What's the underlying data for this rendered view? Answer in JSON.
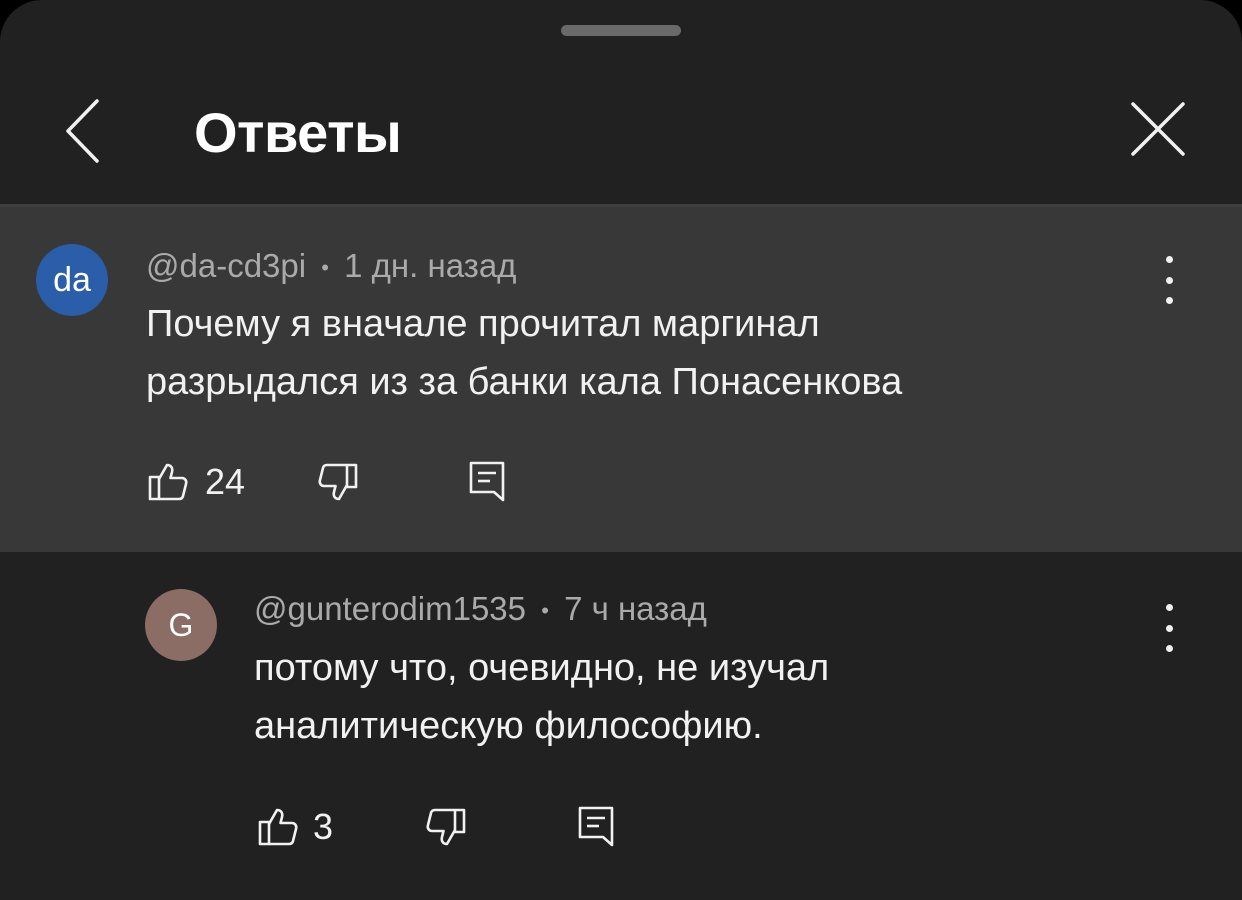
{
  "header": {
    "title": "Ответы"
  },
  "icons": {
    "back": "chevron-left-icon",
    "close": "close-icon",
    "more": "more-vertical-icon",
    "like": "thumbs-up-icon",
    "dislike": "thumbs-down-icon",
    "reply": "reply-comment-icon"
  },
  "colors": {
    "sheet_bg": "#212121",
    "highlight_bg": "#383838",
    "avatar_da": "#2b5ea8",
    "avatar_g": "#8b6d66"
  },
  "parent_comment": {
    "avatar_text": "da",
    "author": "@da-cd3pi",
    "separator": "•",
    "time": "1 дн. назад",
    "text_lines": [
      "Почему я вначале прочитал маргинал",
      "разрыдался из за банки кала Понасенкова"
    ],
    "likes": "24"
  },
  "replies": [
    {
      "avatar_text": "G",
      "author": "@gunterodim1535",
      "separator": "•",
      "time": "7 ч назад",
      "text_lines": [
        "потому что, очевидно, не изучал",
        "аналитическую философию."
      ],
      "likes": "3"
    }
  ]
}
